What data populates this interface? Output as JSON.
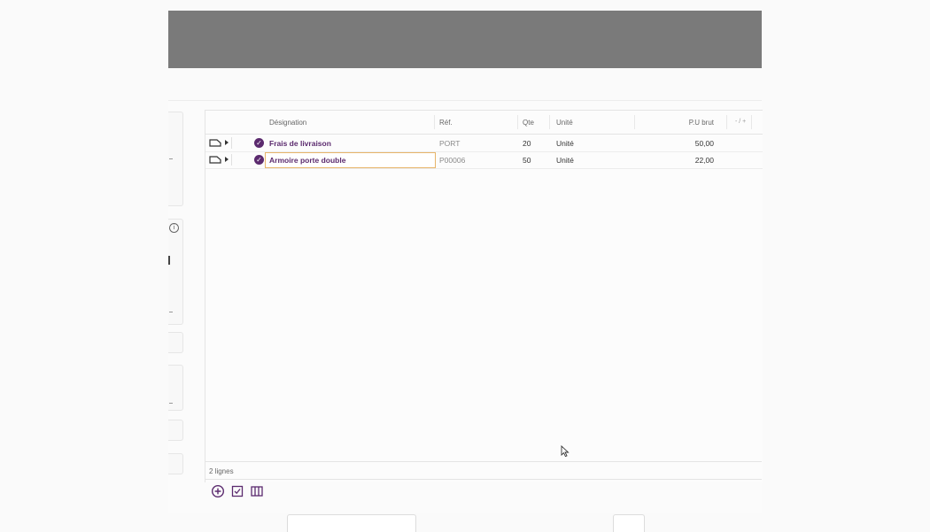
{
  "table": {
    "columns": {
      "designation": "Désignation",
      "ref": "Réf.",
      "qte": "Qte",
      "unite": "Unité",
      "pu_brut": "P.U brut",
      "toggle": "- / +"
    },
    "rows": [
      {
        "designation": "Frais de livraison",
        "ref": "PORT",
        "qte": "20",
        "unite": "Unité",
        "pu_brut": "50,00"
      },
      {
        "designation": "Armoire porte double",
        "ref": "P00006",
        "qte": "50",
        "unite": "Unité",
        "pu_brut": "22,00"
      }
    ],
    "line_count": "2 lignes"
  },
  "icons": {
    "row_document": "document-icon",
    "row_expand": "caret-right-icon",
    "row_validated": "check-circle-icon",
    "side_info": "info-icon",
    "toolbar_add": "plus-circle-icon",
    "toolbar_check": "checkbox-icon",
    "toolbar_columns": "columns-icon"
  },
  "colors": {
    "accent": "#5b2a6e",
    "edit_border": "#e8b56a",
    "header_bar": "#7a7a7a"
  }
}
